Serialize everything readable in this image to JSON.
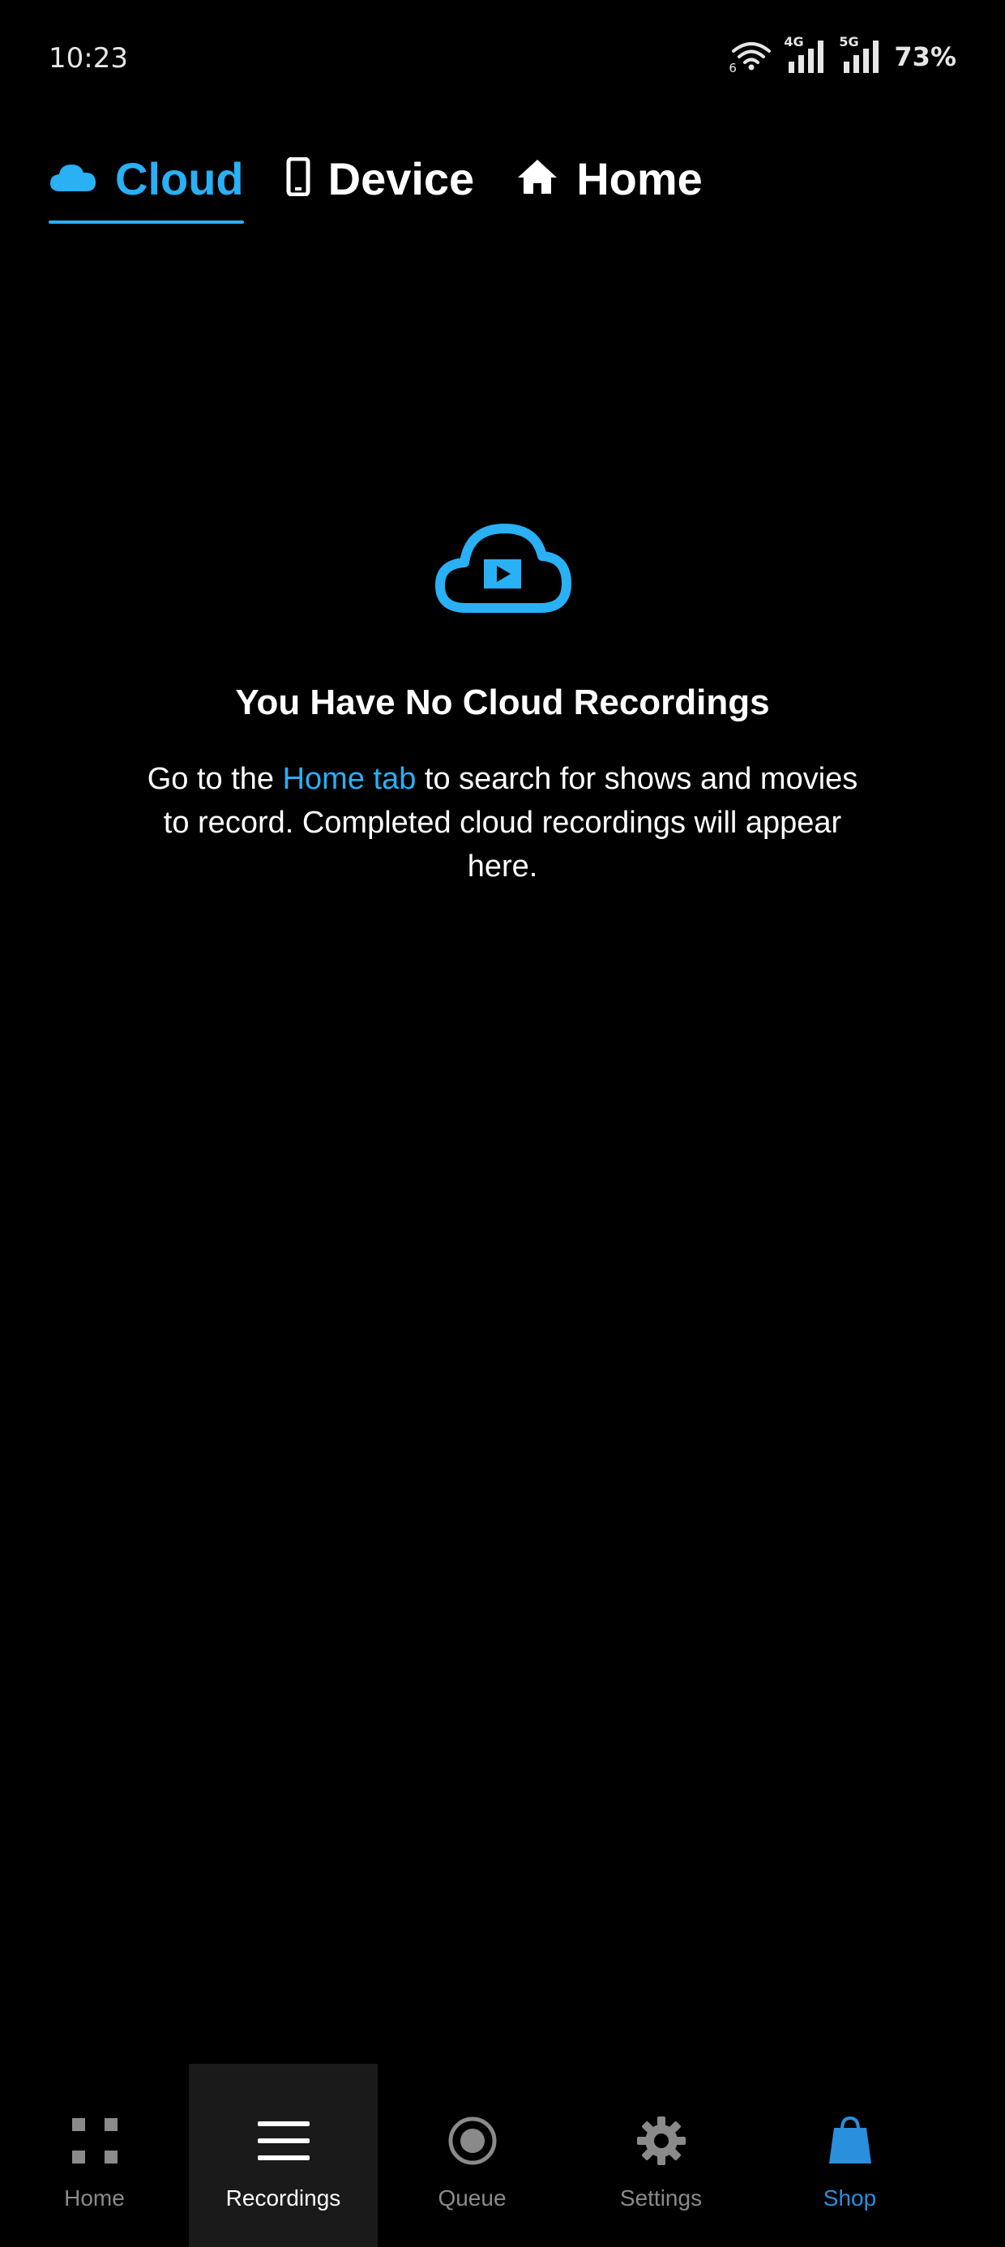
{
  "status_bar": {
    "time": "10:23",
    "wifi_badge": "6",
    "network_1": "4G",
    "network_2": "5G",
    "battery": "73%"
  },
  "tabs": [
    {
      "label": "Cloud",
      "icon": "cloud-icon",
      "active": true
    },
    {
      "label": "Device",
      "icon": "phone-icon",
      "active": false
    },
    {
      "label": "Home",
      "icon": "house-icon",
      "active": false
    }
  ],
  "empty_state": {
    "icon": "cloud-play-icon",
    "title": "You Have No Cloud Recordings",
    "text_before": "Go to the ",
    "link": "Home tab",
    "text_after": " to search for shows and movies to record. Completed cloud recordings will appear here."
  },
  "bottom_nav": [
    {
      "label": "Home",
      "icon": "grid-icon",
      "active": false
    },
    {
      "label": "Recordings",
      "icon": "menu-icon",
      "active": true
    },
    {
      "label": "Queue",
      "icon": "record-icon",
      "active": false
    },
    {
      "label": "Settings",
      "icon": "gear-icon",
      "active": false
    },
    {
      "label": "Shop",
      "icon": "shopping-bag-icon",
      "active": false
    }
  ],
  "colors": {
    "accent": "#29b0f5",
    "shop": "#2a8fdc",
    "background": "#000000",
    "inactive": "#8a8a8a",
    "active_nav_bg": "#1a1a1a"
  }
}
